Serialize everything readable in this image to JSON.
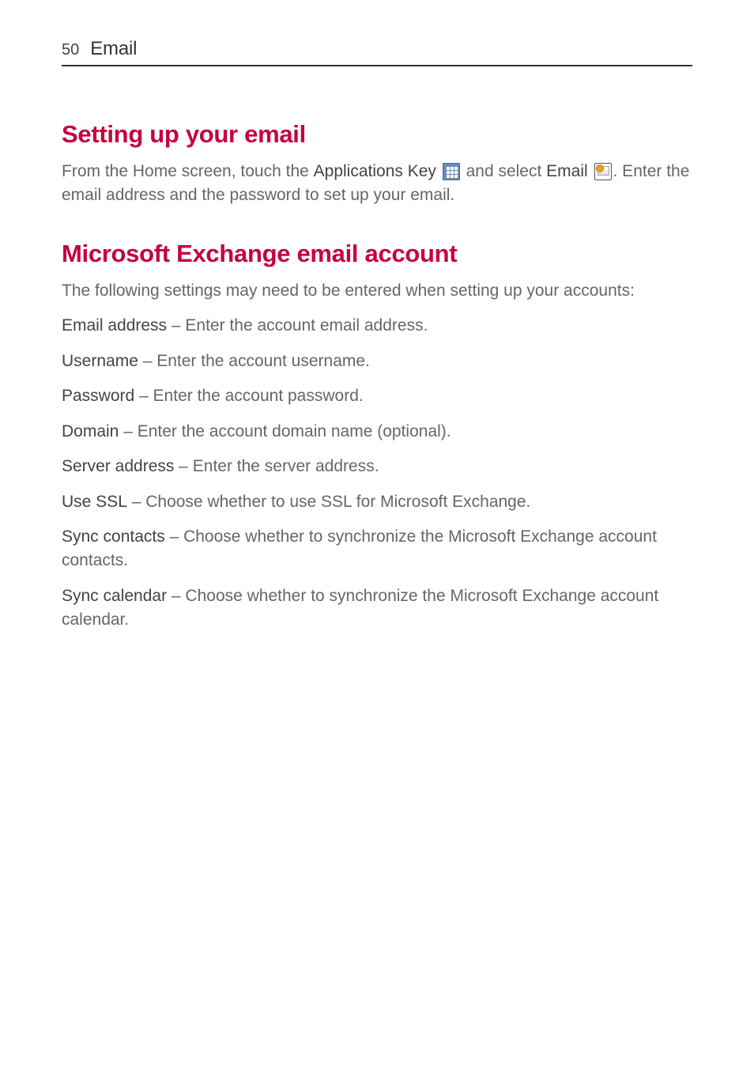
{
  "header": {
    "page_number": "50",
    "title": "Email"
  },
  "section1": {
    "heading": "Setting up your email",
    "text_part1": "From the Home screen, touch the ",
    "bold1": "Applications Key",
    "text_part2": " and select ",
    "bold2": "Email",
    "text_part3": ". Enter the email address and the password to set up your email."
  },
  "section2": {
    "heading": "Microsoft Exchange email account",
    "intro": "The following settings may need to be entered when setting up your accounts:",
    "settings": [
      {
        "label": "Email address",
        "desc": " – Enter the account email address."
      },
      {
        "label": "Username",
        "desc": " – Enter the account username."
      },
      {
        "label": "Password",
        "desc": " – Enter the account password."
      },
      {
        "label": "Domain",
        "desc": " – Enter the account domain name (optional)."
      },
      {
        "label": "Server address",
        "desc": " – Enter the server address."
      },
      {
        "label": "Use SSL",
        "desc": " – Choose whether to use SSL for Microsoft Exchange."
      },
      {
        "label": "Sync contacts",
        "desc": " – Choose whether to synchronize the Microsoft Exchange account contacts."
      },
      {
        "label": "Sync calendar",
        "desc": " – Choose whether to synchronize the Microsoft Exchange account calendar."
      }
    ]
  }
}
